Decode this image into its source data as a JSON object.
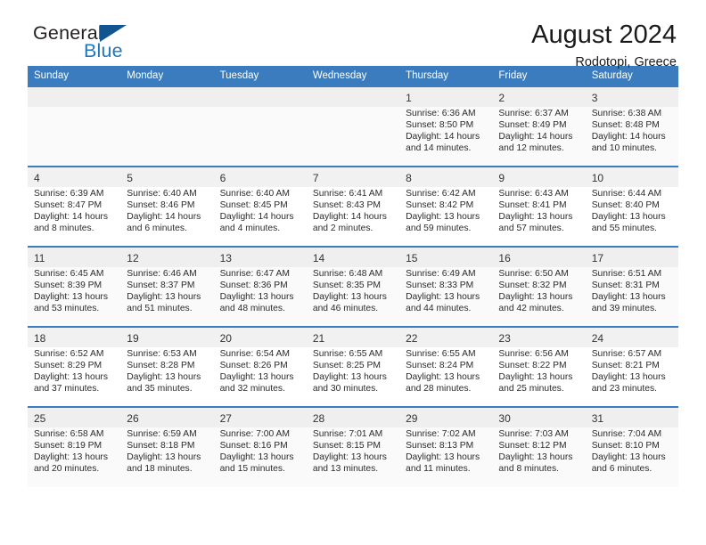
{
  "brand": {
    "name_part1": "General",
    "name_part2": "Blue",
    "triangle_color": "#10558f",
    "blue_color": "#2077c0"
  },
  "header": {
    "title": "August 2024",
    "subtitle": "Rodotopi, Greece"
  },
  "theme": {
    "header_bar_color": "#3a7cbe",
    "row_divider_color": "#3a7cbe",
    "band_color": "#efefef",
    "shaded_row_color": "#fafafa"
  },
  "weekdays": [
    "Sunday",
    "Monday",
    "Tuesday",
    "Wednesday",
    "Thursday",
    "Friday",
    "Saturday"
  ],
  "labels": {
    "sunrise_prefix": "Sunrise:",
    "sunset_prefix": "Sunset:",
    "daylight_prefix": "Daylight:"
  },
  "weeks": [
    {
      "shaded": true,
      "days": [
        {
          "num": "",
          "empty": true
        },
        {
          "num": "",
          "empty": true
        },
        {
          "num": "",
          "empty": true
        },
        {
          "num": "",
          "empty": true
        },
        {
          "num": "1",
          "sunrise": "Sunrise: 6:36 AM",
          "sunset": "Sunset: 8:50 PM",
          "daylight_l1": "Daylight: 14 hours",
          "daylight_l2": "and 14 minutes."
        },
        {
          "num": "2",
          "sunrise": "Sunrise: 6:37 AM",
          "sunset": "Sunset: 8:49 PM",
          "daylight_l1": "Daylight: 14 hours",
          "daylight_l2": "and 12 minutes."
        },
        {
          "num": "3",
          "sunrise": "Sunrise: 6:38 AM",
          "sunset": "Sunset: 8:48 PM",
          "daylight_l1": "Daylight: 14 hours",
          "daylight_l2": "and 10 minutes."
        }
      ]
    },
    {
      "shaded": false,
      "days": [
        {
          "num": "4",
          "sunrise": "Sunrise: 6:39 AM",
          "sunset": "Sunset: 8:47 PM",
          "daylight_l1": "Daylight: 14 hours",
          "daylight_l2": "and 8 minutes."
        },
        {
          "num": "5",
          "sunrise": "Sunrise: 6:40 AM",
          "sunset": "Sunset: 8:46 PM",
          "daylight_l1": "Daylight: 14 hours",
          "daylight_l2": "and 6 minutes."
        },
        {
          "num": "6",
          "sunrise": "Sunrise: 6:40 AM",
          "sunset": "Sunset: 8:45 PM",
          "daylight_l1": "Daylight: 14 hours",
          "daylight_l2": "and 4 minutes."
        },
        {
          "num": "7",
          "sunrise": "Sunrise: 6:41 AM",
          "sunset": "Sunset: 8:43 PM",
          "daylight_l1": "Daylight: 14 hours",
          "daylight_l2": "and 2 minutes."
        },
        {
          "num": "8",
          "sunrise": "Sunrise: 6:42 AM",
          "sunset": "Sunset: 8:42 PM",
          "daylight_l1": "Daylight: 13 hours",
          "daylight_l2": "and 59 minutes."
        },
        {
          "num": "9",
          "sunrise": "Sunrise: 6:43 AM",
          "sunset": "Sunset: 8:41 PM",
          "daylight_l1": "Daylight: 13 hours",
          "daylight_l2": "and 57 minutes."
        },
        {
          "num": "10",
          "sunrise": "Sunrise: 6:44 AM",
          "sunset": "Sunset: 8:40 PM",
          "daylight_l1": "Daylight: 13 hours",
          "daylight_l2": "and 55 minutes."
        }
      ]
    },
    {
      "shaded": true,
      "days": [
        {
          "num": "11",
          "sunrise": "Sunrise: 6:45 AM",
          "sunset": "Sunset: 8:39 PM",
          "daylight_l1": "Daylight: 13 hours",
          "daylight_l2": "and 53 minutes."
        },
        {
          "num": "12",
          "sunrise": "Sunrise: 6:46 AM",
          "sunset": "Sunset: 8:37 PM",
          "daylight_l1": "Daylight: 13 hours",
          "daylight_l2": "and 51 minutes."
        },
        {
          "num": "13",
          "sunrise": "Sunrise: 6:47 AM",
          "sunset": "Sunset: 8:36 PM",
          "daylight_l1": "Daylight: 13 hours",
          "daylight_l2": "and 48 minutes."
        },
        {
          "num": "14",
          "sunrise": "Sunrise: 6:48 AM",
          "sunset": "Sunset: 8:35 PM",
          "daylight_l1": "Daylight: 13 hours",
          "daylight_l2": "and 46 minutes."
        },
        {
          "num": "15",
          "sunrise": "Sunrise: 6:49 AM",
          "sunset": "Sunset: 8:33 PM",
          "daylight_l1": "Daylight: 13 hours",
          "daylight_l2": "and 44 minutes."
        },
        {
          "num": "16",
          "sunrise": "Sunrise: 6:50 AM",
          "sunset": "Sunset: 8:32 PM",
          "daylight_l1": "Daylight: 13 hours",
          "daylight_l2": "and 42 minutes."
        },
        {
          "num": "17",
          "sunrise": "Sunrise: 6:51 AM",
          "sunset": "Sunset: 8:31 PM",
          "daylight_l1": "Daylight: 13 hours",
          "daylight_l2": "and 39 minutes."
        }
      ]
    },
    {
      "shaded": false,
      "days": [
        {
          "num": "18",
          "sunrise": "Sunrise: 6:52 AM",
          "sunset": "Sunset: 8:29 PM",
          "daylight_l1": "Daylight: 13 hours",
          "daylight_l2": "and 37 minutes."
        },
        {
          "num": "19",
          "sunrise": "Sunrise: 6:53 AM",
          "sunset": "Sunset: 8:28 PM",
          "daylight_l1": "Daylight: 13 hours",
          "daylight_l2": "and 35 minutes."
        },
        {
          "num": "20",
          "sunrise": "Sunrise: 6:54 AM",
          "sunset": "Sunset: 8:26 PM",
          "daylight_l1": "Daylight: 13 hours",
          "daylight_l2": "and 32 minutes."
        },
        {
          "num": "21",
          "sunrise": "Sunrise: 6:55 AM",
          "sunset": "Sunset: 8:25 PM",
          "daylight_l1": "Daylight: 13 hours",
          "daylight_l2": "and 30 minutes."
        },
        {
          "num": "22",
          "sunrise": "Sunrise: 6:55 AM",
          "sunset": "Sunset: 8:24 PM",
          "daylight_l1": "Daylight: 13 hours",
          "daylight_l2": "and 28 minutes."
        },
        {
          "num": "23",
          "sunrise": "Sunrise: 6:56 AM",
          "sunset": "Sunset: 8:22 PM",
          "daylight_l1": "Daylight: 13 hours",
          "daylight_l2": "and 25 minutes."
        },
        {
          "num": "24",
          "sunrise": "Sunrise: 6:57 AM",
          "sunset": "Sunset: 8:21 PM",
          "daylight_l1": "Daylight: 13 hours",
          "daylight_l2": "and 23 minutes."
        }
      ]
    },
    {
      "shaded": true,
      "days": [
        {
          "num": "25",
          "sunrise": "Sunrise: 6:58 AM",
          "sunset": "Sunset: 8:19 PM",
          "daylight_l1": "Daylight: 13 hours",
          "daylight_l2": "and 20 minutes."
        },
        {
          "num": "26",
          "sunrise": "Sunrise: 6:59 AM",
          "sunset": "Sunset: 8:18 PM",
          "daylight_l1": "Daylight: 13 hours",
          "daylight_l2": "and 18 minutes."
        },
        {
          "num": "27",
          "sunrise": "Sunrise: 7:00 AM",
          "sunset": "Sunset: 8:16 PM",
          "daylight_l1": "Daylight: 13 hours",
          "daylight_l2": "and 15 minutes."
        },
        {
          "num": "28",
          "sunrise": "Sunrise: 7:01 AM",
          "sunset": "Sunset: 8:15 PM",
          "daylight_l1": "Daylight: 13 hours",
          "daylight_l2": "and 13 minutes."
        },
        {
          "num": "29",
          "sunrise": "Sunrise: 7:02 AM",
          "sunset": "Sunset: 8:13 PM",
          "daylight_l1": "Daylight: 13 hours",
          "daylight_l2": "and 11 minutes."
        },
        {
          "num": "30",
          "sunrise": "Sunrise: 7:03 AM",
          "sunset": "Sunset: 8:12 PM",
          "daylight_l1": "Daylight: 13 hours",
          "daylight_l2": "and 8 minutes."
        },
        {
          "num": "31",
          "sunrise": "Sunrise: 7:04 AM",
          "sunset": "Sunset: 8:10 PM",
          "daylight_l1": "Daylight: 13 hours",
          "daylight_l2": "and 6 minutes."
        }
      ]
    }
  ]
}
